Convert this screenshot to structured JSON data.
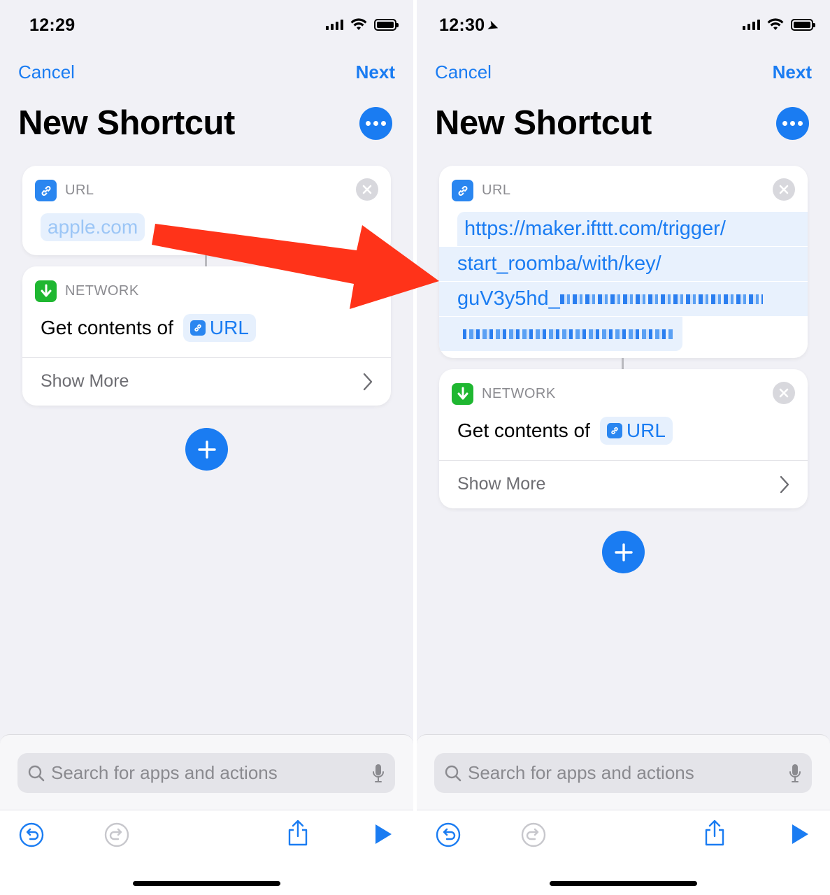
{
  "left": {
    "status": {
      "time": "12:29"
    },
    "nav": {
      "cancel": "Cancel",
      "next": "Next"
    },
    "title": "New Shortcut",
    "url_card": {
      "category": "URL",
      "placeholder": "apple.com"
    },
    "network_card": {
      "category": "NETWORK",
      "action": "Get contents of",
      "variable": "URL",
      "show_more": "Show More"
    },
    "search": {
      "placeholder": "Search for apps and actions"
    }
  },
  "right": {
    "status": {
      "time": "12:30"
    },
    "nav": {
      "cancel": "Cancel",
      "next": "Next"
    },
    "title": "New Shortcut",
    "url_card": {
      "category": "URL",
      "lines": [
        "https://maker.ifttt.com/trigger/",
        "start_roomba/with/key/",
        "guV3y5hd_"
      ]
    },
    "network_card": {
      "category": "NETWORK",
      "action": "Get contents of",
      "variable": "URL",
      "show_more": "Show More"
    },
    "search": {
      "placeholder": "Search for apps and actions"
    }
  },
  "icons": {
    "more": "ellipsis-icon",
    "link": "link-icon",
    "download": "download-arrow-icon",
    "close": "close-icon",
    "add": "plus-icon",
    "search": "magnifier-icon",
    "mic": "microphone-icon",
    "undo": "undo-icon",
    "redo": "redo-icon",
    "share": "share-icon",
    "play": "play-icon"
  },
  "colors": {
    "accent": "#1a7cf2",
    "network_green": "#1fb731",
    "annotation_arrow": "#ff3319"
  }
}
